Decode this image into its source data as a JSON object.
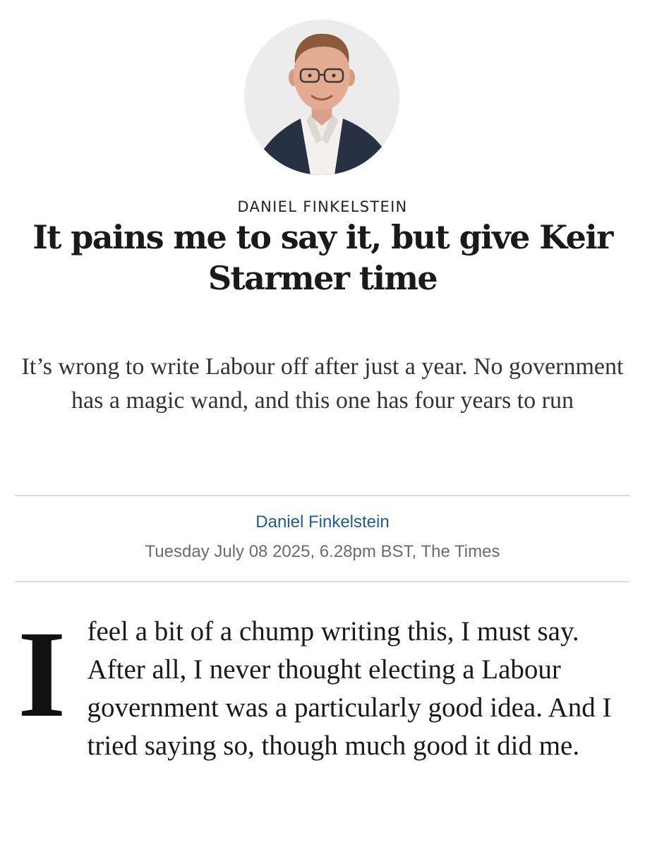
{
  "article": {
    "author_kicker": "DANIEL FINKELSTEIN",
    "headline": "It pains me to say it, but give Keir Starmer time",
    "standfirst": "It’s wrong to write Labour off after just a year. No government has a magic wand, and this one has four years to run",
    "byline": "Daniel Finkelstein",
    "dateline": "Tuesday July 08 2025, 6.28pm BST, The Times",
    "body": {
      "drop_cap": "I",
      "first_paragraph_rest": "feel a bit of a chump writing this, I must say. After all, I never thought electing a Labour government was a particularly good idea. And I tried saying so, though much good it did me."
    }
  },
  "colors": {
    "byline_link": "#1f5b96",
    "meta_text": "#6b6b6b",
    "divider": "#dcdcdc",
    "avatar_bg": "#ececec"
  },
  "icons": {
    "avatar": "author-portrait"
  }
}
